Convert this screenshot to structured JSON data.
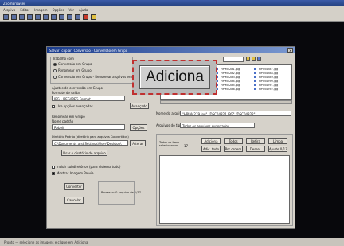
{
  "app": {
    "title": "ZoomBrowser",
    "menu": [
      "Arquivo",
      "Editar",
      "Imagem",
      "Opções",
      "Ver",
      "Ajuda"
    ],
    "status_text": "Pronto — selecione as imagens e clique em Adiciona"
  },
  "dialog": {
    "title": "Salvar (copiar) Conversão - Conversão em Grupo",
    "close_label": "x",
    "work_group_label": "Trabalho com",
    "work_options": [
      {
        "label": "Conversão em Grupo",
        "selected": true
      },
      {
        "label": "Renomear em Grupo",
        "selected": false
      },
      {
        "label": "Conversão em Grupo - Renomear arquivos em",
        "selected": false
      }
    ],
    "convert_group_label": "Ajustes de conversão em Grupo",
    "output_format_label": "Formato de saída",
    "output_format_value": "JPG - JPEG/JPEG Format",
    "advanced_check_label": "Use opções avançadas",
    "advanced_button": "Avançado",
    "rename_group_label": "Renomear em Grupo",
    "name_pattern_label": "Nome padrão",
    "name_pattern_value": "Rebelt",
    "options_button": "Opções",
    "target_dir_label": "Diretório Padrão (diretório para arquivos Convertidos)",
    "target_dir_value": "C:\\Documents and Settings\\User\\Desktop\\",
    "alter_button": "Alterar",
    "use_source_dir_button": "Usar o diretório de arquivo",
    "include_subdirs_label": "Incluir subdiretórios (para sistema todo)",
    "show_preview_label": "Mostrar Imagem Prévia",
    "convert_button": "Converter",
    "cancel_button": "Cancelar",
    "process_info": "Processo: 0 arquivo de 1/17",
    "file_name_label": "Nome do arquivo",
    "file_name_value": "\"HPIM4279.jpg\" \"DSC04821.JPG\" \"DSC04822\"",
    "file_type_label": "Arquivos do tipo",
    "file_type_value": "Todos os arquivos suportados",
    "selected_label": "Todos os itens selecionados",
    "selected_count": "17",
    "buttons_row1": [
      "Adiciona",
      "Todos",
      "Retira",
      "Limpa"
    ],
    "buttons_row2": [
      "Adic. todo",
      "Por ordem",
      "Dessel.",
      "Ajuste 0/17"
    ],
    "files_col1": [
      "HPIM4281.jpg",
      "HPIM4282.jpg",
      "HPIM4283.jpg",
      "HPIM4284.jpg",
      "HPIM4285.jpg",
      "HPIM4286.jpg"
    ],
    "files_col2": [
      "HPIM4287.jpg",
      "HPIM4288.jpg",
      "HPIM4289.jpg",
      "HPIM4290.jpg",
      "HPIM4291.jpg",
      "HPIM4292.jpg"
    ]
  },
  "callout": {
    "label": "Adiciona"
  },
  "colors": {
    "dialog_title": "#1a3b8c",
    "callout_border": "#c03030"
  }
}
